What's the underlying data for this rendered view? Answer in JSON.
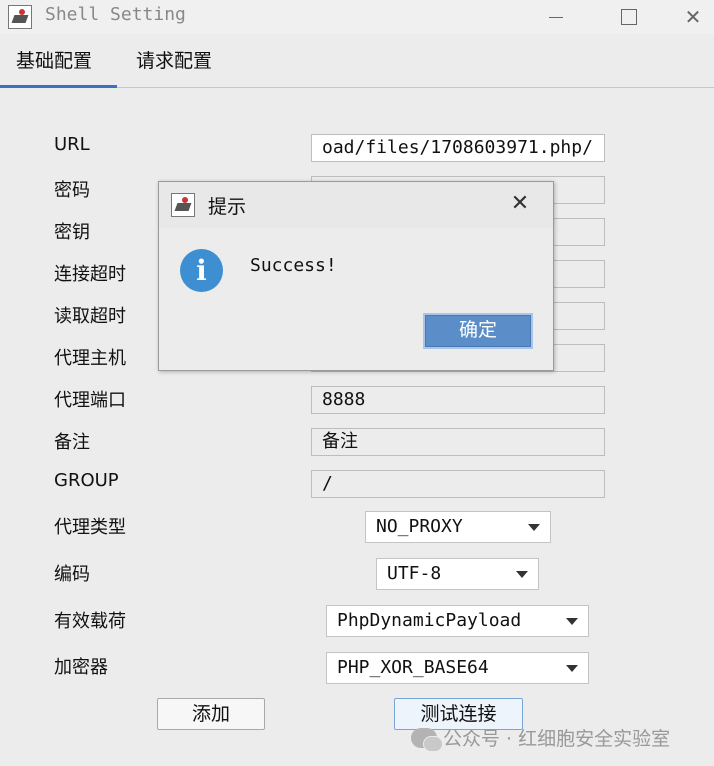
{
  "window": {
    "title": "Shell Setting"
  },
  "tabs": [
    {
      "label": "基础配置"
    },
    {
      "label": "请求配置"
    }
  ],
  "form": {
    "labels": {
      "url": "URL",
      "password": "密码",
      "key": "密钥",
      "connect_timeout": "连接超时",
      "read_timeout": "读取超时",
      "proxy_host": "代理主机",
      "proxy_port": "代理端口",
      "remark": "备注",
      "group": "GROUP",
      "proxy_type": "代理类型",
      "encoding": "编码",
      "payload": "有效载荷",
      "cryption": "加密器"
    },
    "values": {
      "url": "oad/files/1708603971.php/",
      "proxy_port": "8888",
      "remark": "备注",
      "group": "/"
    },
    "selects": {
      "proxy_type": "NO_PROXY",
      "encoding": "UTF-8",
      "payload": "PhpDynamicPayload",
      "cryption": "PHP_XOR_BASE64"
    },
    "buttons": {
      "add": "添加",
      "test": "测试连接"
    }
  },
  "dialog": {
    "title": "提示",
    "message": "Success!",
    "ok_label": "确定",
    "info_glyph": "i"
  },
  "watermark": "公众号 · 红细胞安全实验室",
  "colors": {
    "accent": "#3a73bd",
    "info": "#3d8fd1",
    "ok_button": "#5b8ec9"
  }
}
